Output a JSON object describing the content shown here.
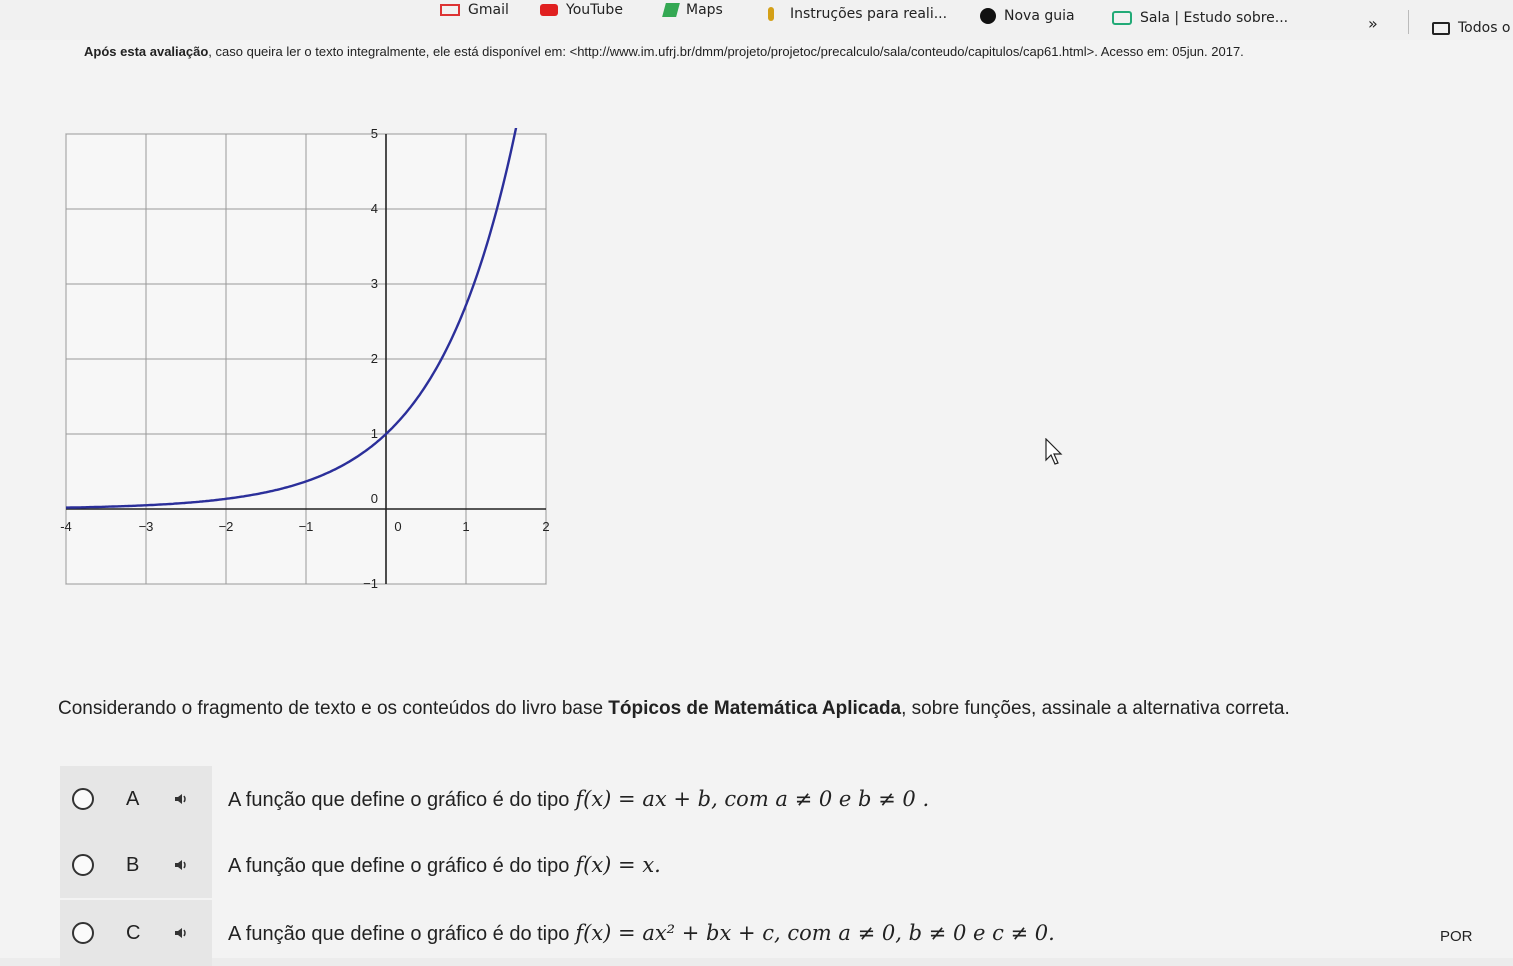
{
  "bookmarks": [
    {
      "label": "Gmail",
      "icon": "gmail-icon"
    },
    {
      "label": "YouTube",
      "icon": "youtube-icon"
    },
    {
      "label": "Maps",
      "icon": "maps-icon"
    },
    {
      "label": "Instruções para reali...",
      "icon": "pin-icon"
    },
    {
      "label": "Nova guia",
      "icon": "globe-icon"
    },
    {
      "label": "Sala | Estudo sobre...",
      "icon": "graduation-cap-icon"
    },
    {
      "label": "Todos o",
      "icon": "folder-icon"
    }
  ],
  "bookmarks_overflow": "»",
  "source": {
    "lead": "Após esta avaliação",
    "text": ", caso queira ler o texto integralmente, ele está disponível em: <http://www.im.ufrj.br/dmm/projeto/projetoc/precalculo/sala/conteudo/capitulos/cap61.html>. Acesso em: 05jun. 2017."
  },
  "chart_data": {
    "type": "line",
    "function": "exponential",
    "xlim": [
      -4,
      2
    ],
    "ylim": [
      -1,
      5
    ],
    "x_ticks": [
      "-4",
      "−3",
      "−2",
      "−1",
      "0",
      "1",
      "2"
    ],
    "y_ticks": [
      "−1",
      "0",
      "1",
      "2",
      "3",
      "4",
      "5"
    ],
    "grid": true,
    "series": [
      {
        "color": "#2b2f9a",
        "x": [
          -4,
          -3.5,
          -3,
          -2.5,
          -2,
          -1.5,
          -1,
          -0.5,
          0,
          0.5,
          1,
          1.5,
          1.7
        ],
        "y": [
          0.02,
          0.03,
          0.05,
          0.08,
          0.14,
          0.22,
          0.37,
          0.61,
          1,
          1.65,
          2.72,
          4.48,
          5.4
        ]
      }
    ]
  },
  "question": {
    "pre": "Considerando o fragmento de texto e os conteúdos do livro base ",
    "book": "Tópicos de Matemática Aplicada",
    "post": ", sobre funções, assinale a alternativa correta."
  },
  "options": [
    {
      "letter": "A",
      "text": "A função que define o gráfico é do tipo",
      "math": "f(x) = ax + b, com a ≠ 0 e b ≠ 0 ."
    },
    {
      "letter": "B",
      "text": "A função que define o gráfico é do tipo",
      "math": "f(x) = x."
    },
    {
      "letter": "C",
      "text": "A função que define o gráfico é do tipo",
      "math": "f(x) = ax² + bx + c, com a ≠ 0, b ≠ 0 e c ≠ 0."
    }
  ],
  "taskbar": {
    "language": "POR"
  }
}
